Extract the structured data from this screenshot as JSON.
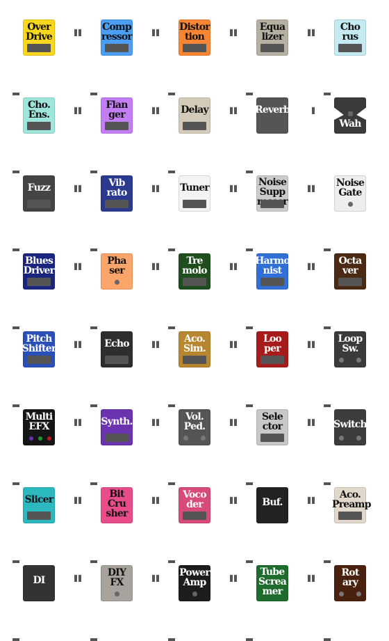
{
  "pedals": [
    {
      "lines": [
        "Over",
        "Drive"
      ],
      "color": "#f9d71c",
      "text": "#111",
      "style": "bar"
    },
    {
      "lines": [
        "Comp",
        "ressor"
      ],
      "color": "#4a9ff5",
      "text": "#111",
      "style": "bar"
    },
    {
      "lines": [
        "Distor",
        "tion"
      ],
      "color": "#fa8532",
      "text": "#111",
      "style": "bar"
    },
    {
      "lines": [
        "Equa",
        "lizer"
      ],
      "color": "#b5b0a2",
      "text": "#111",
      "style": "bar"
    },
    {
      "lines": [
        "Cho",
        "rus"
      ],
      "color": "#c4eaf2",
      "text": "#111",
      "style": "bar"
    },
    {
      "lines": [
        "Cho.",
        "Ens."
      ],
      "color": "#9ee6dc",
      "text": "#111",
      "style": "bar"
    },
    {
      "lines": [
        "Flan",
        "ger"
      ],
      "color": "#c47ef5",
      "text": "#111",
      "style": "bar"
    },
    {
      "lines": [
        "Delay"
      ],
      "color": "#d4cab9",
      "text": "#111",
      "style": "bar"
    },
    {
      "lines": [
        "Reverb"
      ],
      "color": "#555555",
      "text": "#fff",
      "style": "bar"
    },
    {
      "lines": [
        "Wah"
      ],
      "color": "#3a3a3a",
      "text": "#fff",
      "style": "wah"
    },
    {
      "lines": [
        "Fuzz"
      ],
      "color": "#444444",
      "text": "#fff",
      "style": "bar"
    },
    {
      "lines": [
        "Vib",
        "rato"
      ],
      "color": "#2b3a8f",
      "text": "#fff",
      "style": "bar"
    },
    {
      "lines": [
        "Tuner"
      ],
      "color": "#f4f4f4",
      "text": "#111",
      "style": "bar"
    },
    {
      "lines": [
        "Noise",
        "Supp",
        "ressor"
      ],
      "color": "#cccccc",
      "text": "#111",
      "style": "bar"
    },
    {
      "lines": [
        "Noise",
        "Gate"
      ],
      "color": "#eeeeee",
      "text": "#111",
      "style": "knob"
    },
    {
      "lines": [
        "Blues",
        "Driver"
      ],
      "color": "#1a2580",
      "text": "#fff",
      "style": "bar"
    },
    {
      "lines": [
        "Pha",
        "ser"
      ],
      "color": "#fba56a",
      "text": "#111",
      "style": "knob"
    },
    {
      "lines": [
        "Tre",
        "molo"
      ],
      "color": "#1e4d1e",
      "text": "#fff",
      "style": "bar"
    },
    {
      "lines": [
        "Harmo",
        "nist"
      ],
      "color": "#2f6fd6",
      "text": "#fff",
      "style": "bar"
    },
    {
      "lines": [
        "Octa",
        "ver"
      ],
      "color": "#4a2a12",
      "text": "#fff",
      "style": "bar"
    },
    {
      "lines": [
        "Pitch",
        "Shifter"
      ],
      "color": "#2a4fb8",
      "text": "#fff",
      "style": "bar"
    },
    {
      "lines": [
        "Echo"
      ],
      "color": "#2e2e2e",
      "text": "#fff",
      "style": "bar"
    },
    {
      "lines": [
        "Aco.",
        "Sim."
      ],
      "color": "#b8862f",
      "text": "#fff",
      "style": "bar"
    },
    {
      "lines": [
        "Loo",
        "per"
      ],
      "color": "#a81b1b",
      "text": "#fff",
      "style": "bar"
    },
    {
      "lines": [
        "Loop",
        "Sw."
      ],
      "color": "#3a3a3a",
      "text": "#fff",
      "style": "twobtn"
    },
    {
      "lines": [
        "Multi",
        "EFX"
      ],
      "color": "#151515",
      "text": "#fff",
      "style": "leds"
    },
    {
      "lines": [
        "Synth."
      ],
      "color": "#6c33b0",
      "text": "#fff",
      "style": "bar"
    },
    {
      "lines": [
        "Vol.",
        "Ped."
      ],
      "color": "#555555",
      "text": "#fff",
      "style": "twobtn"
    },
    {
      "lines": [
        "Sele",
        "ctor"
      ],
      "color": "#c8c8c8",
      "text": "#111",
      "style": "bar"
    },
    {
      "lines": [
        "Switch"
      ],
      "color": "#3c3c3c",
      "text": "#fff",
      "style": "twobtn"
    },
    {
      "lines": [
        "Slicer"
      ],
      "color": "#2bb8be",
      "text": "#111",
      "style": "bar"
    },
    {
      "lines": [
        "Bit",
        "Cru",
        "sher"
      ],
      "color": "#e84d8a",
      "text": "#111",
      "style": "none"
    },
    {
      "lines": [
        "Voco",
        "der"
      ],
      "color": "#d84a7a",
      "text": "#fff",
      "style": "bar"
    },
    {
      "lines": [
        "Buf."
      ],
      "color": "#222222",
      "text": "#fff",
      "style": "none"
    },
    {
      "lines": [
        "Aco.",
        "Preamp"
      ],
      "color": "#e2d9cc",
      "text": "#111",
      "style": "bar"
    },
    {
      "lines": [
        "DI"
      ],
      "color": "#333333",
      "text": "#fff",
      "style": "none"
    },
    {
      "lines": [
        "DIY",
        "FX"
      ],
      "color": "#a8a49d",
      "text": "#111",
      "style": "knob"
    },
    {
      "lines": [
        "Power",
        "Amp"
      ],
      "color": "#1c1c1c",
      "text": "#fff",
      "style": "knob"
    },
    {
      "lines": [
        "Tube",
        "Screa",
        "mer"
      ],
      "color": "#1e6b2e",
      "text": "#fff",
      "style": "none"
    },
    {
      "lines": [
        "Rot",
        "ary"
      ],
      "color": "#4a200e",
      "text": "#fff",
      "style": "twobtn"
    }
  ]
}
